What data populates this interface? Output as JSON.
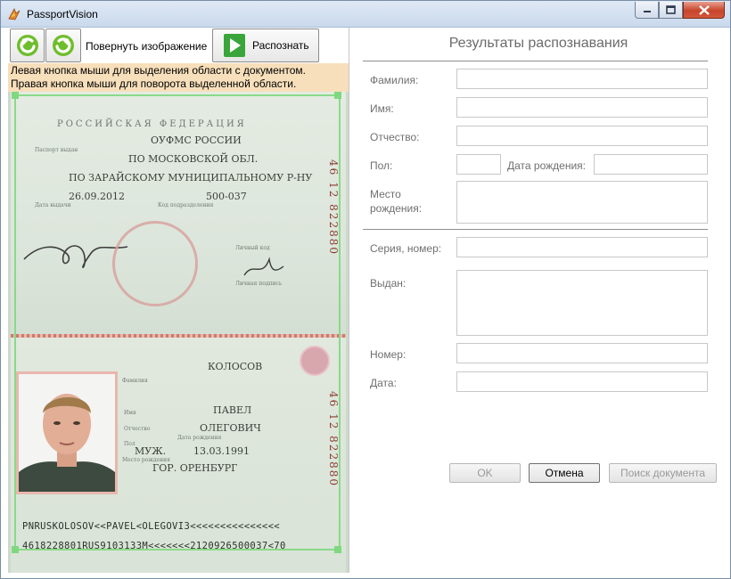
{
  "window": {
    "title": "PassportVision"
  },
  "toolbar": {
    "rotate_label": "Повернуть изображение",
    "recognize_label": "Распознать"
  },
  "hint": {
    "line1": "Левая кнопка мыши для выделения области с документом.",
    "line2": "Правая кнопка мыши для поворота выделенной области."
  },
  "passport": {
    "header": "РОССИЙСКАЯ  ФЕДЕРАЦИЯ",
    "issued_label": "Паспорт выдан",
    "issuer_line1": "ОУФМС РОССИИ",
    "issuer_line2": "ПО МОСКОВСКОЙ ОБЛ.",
    "issuer_line3": "ПО ЗАРАЙСКОМУ МУНИЦИПАЛЬНОМУ Р-НУ",
    "issue_date": "26.09.2012",
    "dept_code": "500-037",
    "issue_date_label": "Дата выдачи",
    "dept_code_label": "Код подразделения",
    "signature_label": "Личный код",
    "holder_signature_label": "Личная подпись",
    "serial": "46  12  822880",
    "surname_label": "Фамилия",
    "surname": "КОЛОСОВ",
    "name_label": "Имя",
    "name": "ПАВЕЛ",
    "patronymic_label": "Отчество",
    "patronymic": "ОЛЕГОВИЧ",
    "sex_label": "Пол",
    "sex": "МУЖ.",
    "birth_label": "Дата рождения",
    "birth_date": "13.03.1991",
    "place_label": "Место рождения",
    "place": "ГОР. ОРЕНБУРГ",
    "mrz_line1": "PNRUSKOLOSOV<<PAVEL<OLEGOVI3<<<<<<<<<<<<<<<",
    "mrz_line2": "4618228801RUS9103133M<<<<<<<2120926500037<70"
  },
  "results": {
    "title": "Результаты распознавания",
    "surname_label": "Фамилия:",
    "name_label": "Имя:",
    "patronymic_label": "Отчество:",
    "sex_label": "Пол:",
    "birth_label": "Дата рождения:",
    "place_label_1": "Место",
    "place_label_2": "рождения:",
    "series_label": "Серия, номер:",
    "issued_label": "Выдан:",
    "number_label": "Номер:",
    "date_label": "Дата:",
    "surname": "",
    "name": "",
    "patronymic": "",
    "sex": "",
    "birth_date": "",
    "place": "",
    "series": "",
    "issued": "",
    "number": "",
    "date": ""
  },
  "buttons": {
    "ok": "OK",
    "cancel": "Отмена",
    "search": "Поиск документа"
  }
}
